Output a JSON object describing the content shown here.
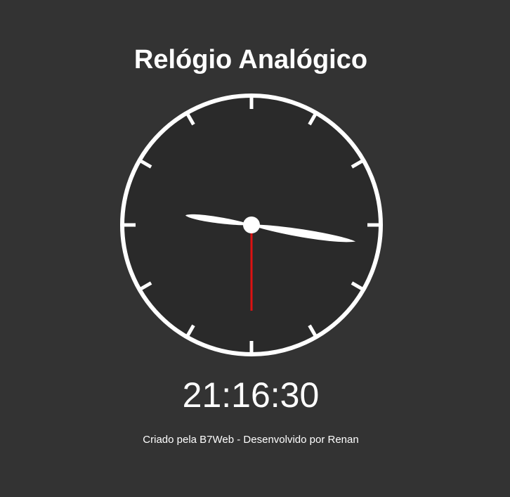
{
  "title": "Relógio Analógico",
  "clock": {
    "hours": 21,
    "minutes": 16,
    "seconds": 30,
    "face_color": "#2a2a2a",
    "rim_color": "#ffffff",
    "second_hand_color": "#dd1111"
  },
  "digital_time": "21:16:30",
  "footer": "Criado pela B7Web - Desenvolvido por Renan",
  "colors": {
    "background": "#333333",
    "text": "#ffffff"
  }
}
